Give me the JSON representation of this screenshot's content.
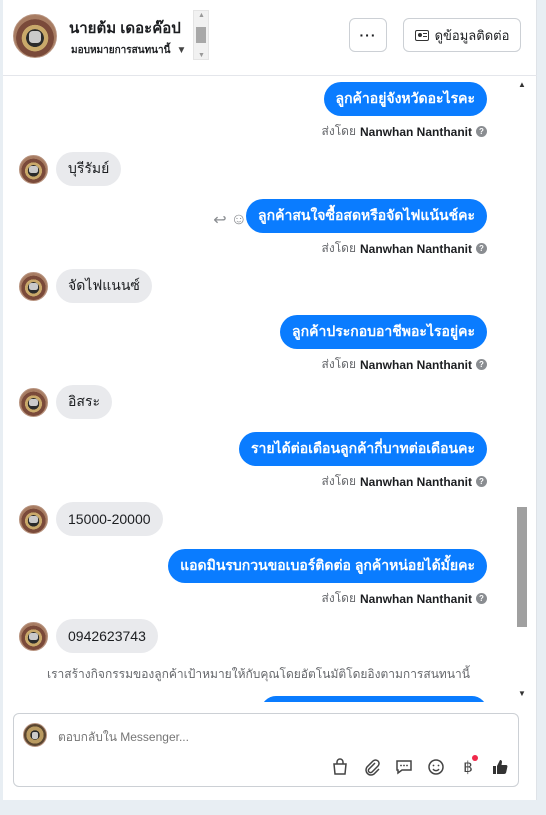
{
  "header": {
    "name": "นายต้ม เดอะค๊อป",
    "assign_label": "มอบหมายการสนทนานี้",
    "more_label": "···",
    "contact_button": "ดูข้อมูลติดต่อ"
  },
  "sent_by_prefix": "ส่งโดย",
  "sender_name": "Nanwhan Nanthanit",
  "messages": [
    {
      "dir": "out",
      "text": "ลูกค้าอยู่จังหวัดอะไรคะ"
    },
    {
      "dir": "in",
      "text": "บุรีรัมย์"
    },
    {
      "dir": "out",
      "text": "ลูกค้าสนใจซื้อสดหรือจัดไฟแน้นช์คะ"
    },
    {
      "dir": "in",
      "text": "จัดไฟแนนซ์"
    },
    {
      "dir": "out",
      "text": "ลูกค้าประกอบอาชีพอะไรอยู่คะ"
    },
    {
      "dir": "in",
      "text": "อิสระ"
    },
    {
      "dir": "out",
      "text": "รายได้ต่อเดือนลูกค้ากี่บาทต่อเดือนคะ"
    },
    {
      "dir": "in",
      "text": "15000-20000"
    },
    {
      "dir": "out",
      "text": "แอดมินรบกวนขอเบอร์ติดต่อ ลูกค้าหน่อยได้มั้ยคะ"
    },
    {
      "dir": "in",
      "text": "0942623743"
    }
  ],
  "note": "เราสร้างกิจกรรมของลูกค้าเป้าหมายให้กับคุณโดยอัตโนมัติโดยอิงตามการสนทนานี้",
  "composer": {
    "placeholder": "ตอบกลับใน Messenger..."
  },
  "icons": {
    "more": "more-horizontal-icon",
    "contact": "contact-card-icon",
    "reply": "reply-icon",
    "emoji": "emoji-icon",
    "bag": "shopping-bag-icon",
    "attach": "paperclip-icon",
    "saved_reply": "chat-bubble-icon",
    "baht": "baht-icon",
    "like": "thumbs-up-icon"
  },
  "colors": {
    "outgoing_bubble": "#0a7cff",
    "incoming_bubble": "#e9eaed",
    "notification_dot": "#f0284a"
  }
}
